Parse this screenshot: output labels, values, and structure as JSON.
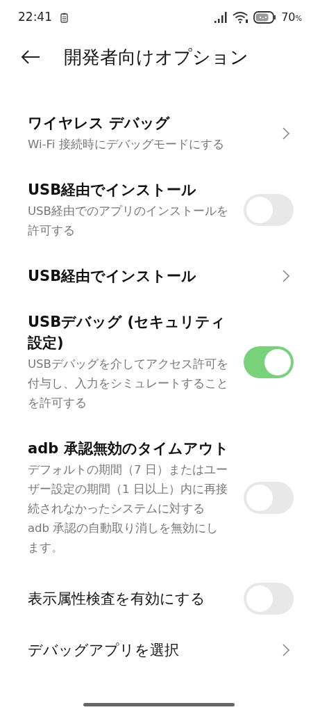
{
  "status_bar": {
    "time": "22:41",
    "battery": "70",
    "battery_unit": "%"
  },
  "header": {
    "title": "開発者向けオプション"
  },
  "items": [
    {
      "kind": "link",
      "title": "ワイヤレス デバッグ",
      "bold": true,
      "subtitle": "Wi-Fi 接続時にデバッグモードにする"
    },
    {
      "kind": "toggle",
      "title": "USB経由でインストール",
      "bold": true,
      "subtitle": "USB経由でのアプリのインストールを許可する",
      "on": false
    },
    {
      "kind": "link",
      "title": "USB経由でインストール",
      "bold": true
    },
    {
      "kind": "toggle",
      "title": "USBデバッグ (セキュリティ設定)",
      "bold": true,
      "subtitle": "USBデバッグを介してアクセス許可を付与し、入力をシミュレートすることを許可する",
      "on": true
    },
    {
      "kind": "toggle",
      "title": "adb 承認無効のタイムアウト",
      "bold": true,
      "subtitle": "デフォルトの期間（7 日）またはユーザー設定の期間（1 日以上）内に再接続されなかったシステムに対する adb 承認の自動取り消しを無効にします。",
      "on": false
    },
    {
      "kind": "toggle",
      "title": "表示属性検査を有効にする",
      "bold": false,
      "on": false
    },
    {
      "kind": "link",
      "title": "デバッグアプリを選択",
      "bold": false
    }
  ]
}
